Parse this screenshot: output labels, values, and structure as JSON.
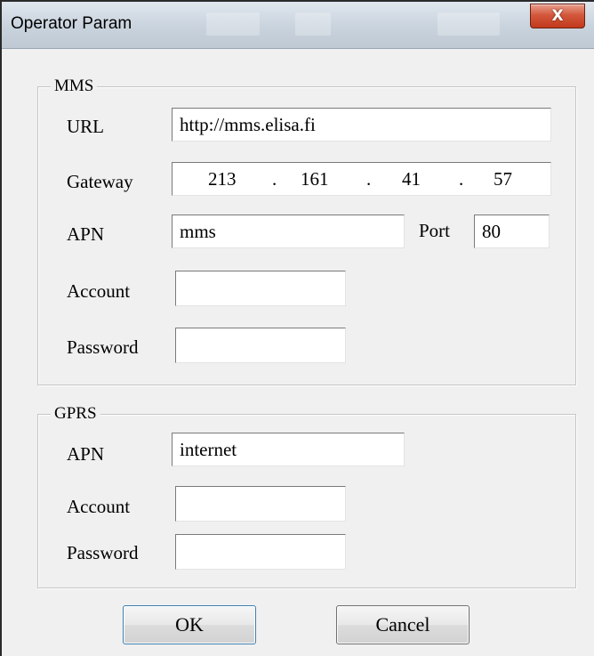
{
  "window": {
    "title": "Operator Param",
    "close_glyph": "X"
  },
  "mms": {
    "legend": "MMS",
    "url": {
      "label": "URL",
      "value": "http://mms.elisa.fi"
    },
    "gateway": {
      "label": "Gateway",
      "octets": [
        "213",
        "161",
        "41",
        "57"
      ],
      "separator": "."
    },
    "apn": {
      "label": "APN",
      "value": "mms"
    },
    "port": {
      "label": "Port",
      "value": "80"
    },
    "account": {
      "label": "Account",
      "value": ""
    },
    "password": {
      "label": "Password",
      "value": ""
    }
  },
  "gprs": {
    "legend": "GPRS",
    "apn": {
      "label": "APN",
      "value": "internet"
    },
    "account": {
      "label": "Account",
      "value": ""
    },
    "password": {
      "label": "Password",
      "value": ""
    }
  },
  "buttons": {
    "ok": "OK",
    "cancel": "Cancel"
  },
  "colors": {
    "close_button": "#c2391c",
    "dialog_bg": "#f0f0f0",
    "titlebar": "#c9d3dd"
  }
}
